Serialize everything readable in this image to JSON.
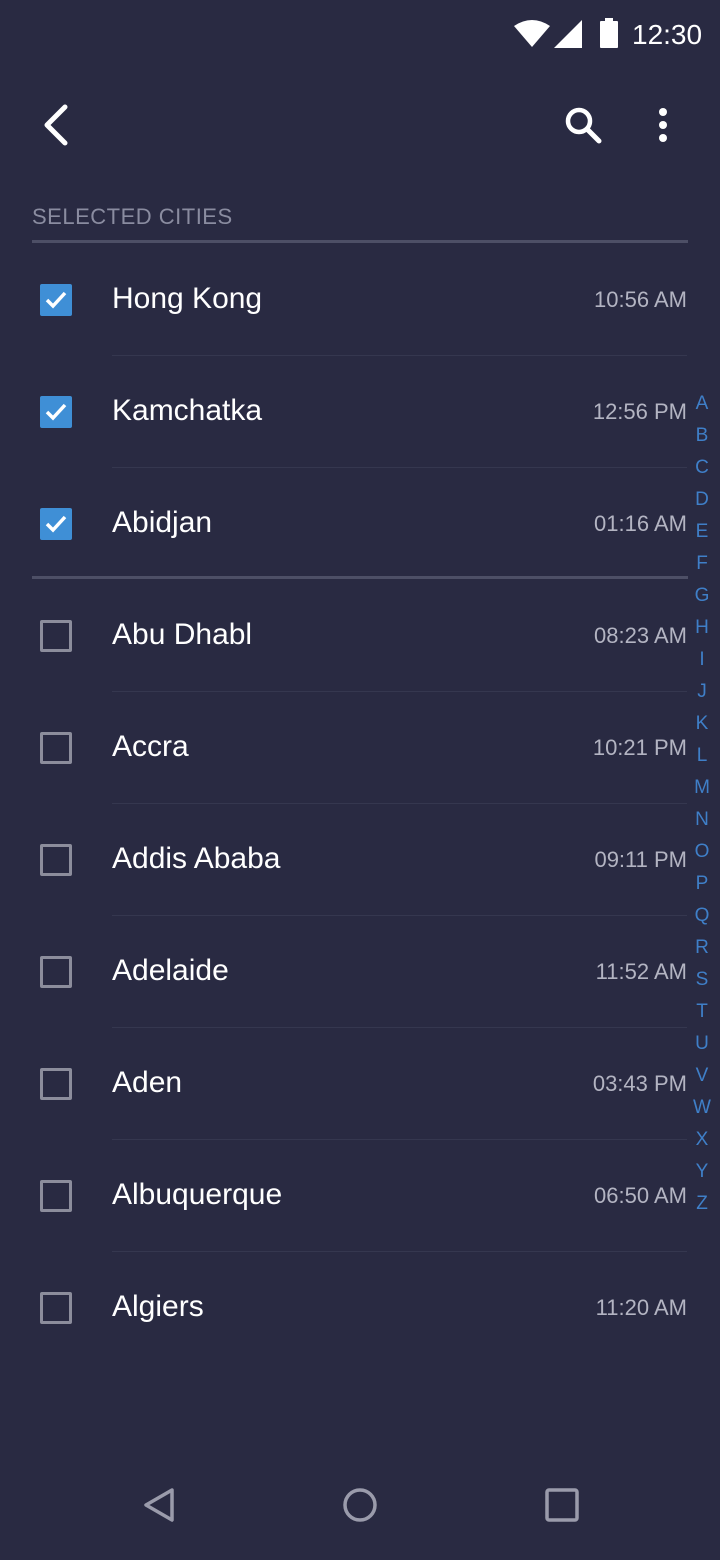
{
  "status_bar": {
    "time": "12:30",
    "icons": [
      "wifi-icon",
      "cellular-signal-icon",
      "battery-icon"
    ]
  },
  "toolbar": {
    "icons": [
      "back-arrow-icon",
      "search-icon",
      "more-vertical-icon"
    ]
  },
  "section": {
    "title": "SELECTED CITIES"
  },
  "selected_cities": [
    {
      "name": "Hong Kong",
      "time": "10:56 AM",
      "checked": true
    },
    {
      "name": "Kamchatka",
      "time": "12:56 PM",
      "checked": true
    },
    {
      "name": "Abidjan",
      "time": "01:16 AM",
      "checked": true
    }
  ],
  "cities": [
    {
      "name": "Abu Dhabl",
      "time": "08:23 AM",
      "checked": false
    },
    {
      "name": "Accra",
      "time": "10:21 PM",
      "checked": false
    },
    {
      "name": "Addis Ababa",
      "time": "09:11 PM",
      "checked": false
    },
    {
      "name": "Adelaide",
      "time": "11:52 AM",
      "checked": false
    },
    {
      "name": "Aden",
      "time": "03:43 PM",
      "checked": false
    },
    {
      "name": "Albuquerque",
      "time": "06:50 AM",
      "checked": false
    },
    {
      "name": "Algiers",
      "time": "11:20 AM",
      "checked": false
    }
  ],
  "alphabet_index": [
    "A",
    "B",
    "C",
    "D",
    "E",
    "F",
    "G",
    "H",
    "I",
    "J",
    "K",
    "L",
    "M",
    "N",
    "O",
    "P",
    "Q",
    "R",
    "S",
    "T",
    "U",
    "V",
    "W",
    "X",
    "Y",
    "Z"
  ],
  "nav_bar": {
    "icons": [
      "nav-back-icon",
      "nav-home-icon",
      "nav-recents-icon"
    ]
  },
  "colors": {
    "background": "#292a42",
    "accent": "#3f8fd6",
    "index_letters": "#3f7fc8",
    "secondary_text": "#b3b4c2",
    "section_header": "#8a8ca0"
  }
}
